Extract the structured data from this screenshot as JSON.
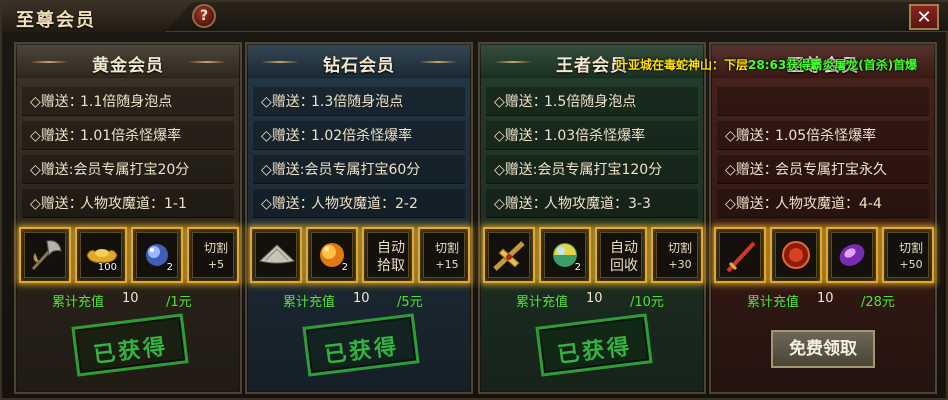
{
  "window": {
    "title": "至尊会员",
    "help_label": "?",
    "close_label": "✕"
  },
  "broadcast": {
    "part1": "叶亚城在毒蛇神山：下层",
    "part2": "28:63获得霸炎屠龙(首杀)首爆"
  },
  "panels": [
    {
      "title": "黄金会员",
      "perks": [
        {
          "prefix": "◇赠送：",
          "text": "1.1倍随身泡点"
        },
        {
          "prefix": "◇赠送：",
          "text": "1.01倍杀怪爆率"
        },
        {
          "prefix": "",
          "text": "◇赠送:会员专属打宝20分"
        },
        {
          "prefix": "◇赠送：",
          "text": "人物攻魔道：1-1"
        }
      ],
      "items": [
        {
          "icon": "axe-icon",
          "qty": ""
        },
        {
          "icon": "gold-ingot-icon",
          "qty": "100"
        },
        {
          "icon": "blue-orb-icon",
          "qty": "2"
        },
        {
          "text": "切割",
          "sub": "+5"
        }
      ],
      "recharge_label": "累计充值",
      "recharge_current": "10",
      "recharge_target": "/1元",
      "status": "已获得"
    },
    {
      "title": "钻石会员",
      "perks": [
        {
          "prefix": "◇赠送：",
          "text": "1.3倍随身泡点"
        },
        {
          "prefix": "◇赠送：",
          "text": "1.02倍杀怪爆率"
        },
        {
          "prefix": "",
          "text": "◇赠送:会员专属打宝60分"
        },
        {
          "prefix": "◇赠送：",
          "text": "人物攻魔道：2-2"
        }
      ],
      "items": [
        {
          "icon": "straw-hat-icon",
          "qty": ""
        },
        {
          "icon": "gold-orb-icon",
          "qty": "2"
        },
        {
          "text": "自动",
          "text2": "拾取"
        },
        {
          "text": "切割",
          "sub": "+15"
        }
      ],
      "recharge_label": "累计充值",
      "recharge_current": "10",
      "recharge_target": "/5元",
      "status": "已获得"
    },
    {
      "title": "王者会员",
      "perks": [
        {
          "prefix": "◇赠送：",
          "text": "1.5倍随身泡点"
        },
        {
          "prefix": "◇赠送：",
          "text": "1.03倍杀怪爆率"
        },
        {
          "prefix": "",
          "text": "◇赠送:会员专属打宝120分"
        },
        {
          "prefix": "◇赠送：",
          "text": "人物攻魔道：3-3"
        }
      ],
      "items": [
        {
          "icon": "dragon-blade-icon",
          "qty": ""
        },
        {
          "icon": "rainbow-orb-icon",
          "qty": "2"
        },
        {
          "text": "自动",
          "text2": "回收"
        },
        {
          "text": "切割",
          "sub": "+30"
        }
      ],
      "recharge_label": "累计充值",
      "recharge_current": "10",
      "recharge_target": "/10元",
      "status": "已获得"
    },
    {
      "title": "至尊会员",
      "perks": [
        {
          "prefix": "◇赠送：",
          "text": "1.05倍杀怪爆率"
        },
        {
          "prefix": "◇赠送：",
          "text": "会员专属打宝永久"
        },
        {
          "prefix": "◇赠送：",
          "text": "人物攻魔道：4-4"
        }
      ],
      "items": [
        {
          "icon": "red-sword-icon",
          "qty": ""
        },
        {
          "icon": "red-medallion-icon",
          "qty": ""
        },
        {
          "icon": "purple-gem-icon",
          "qty": ""
        },
        {
          "text": "切割",
          "sub": "+50"
        }
      ],
      "recharge_label": "累计充值",
      "recharge_current": "10",
      "recharge_target": "/28元",
      "button": "免费领取"
    }
  ]
}
